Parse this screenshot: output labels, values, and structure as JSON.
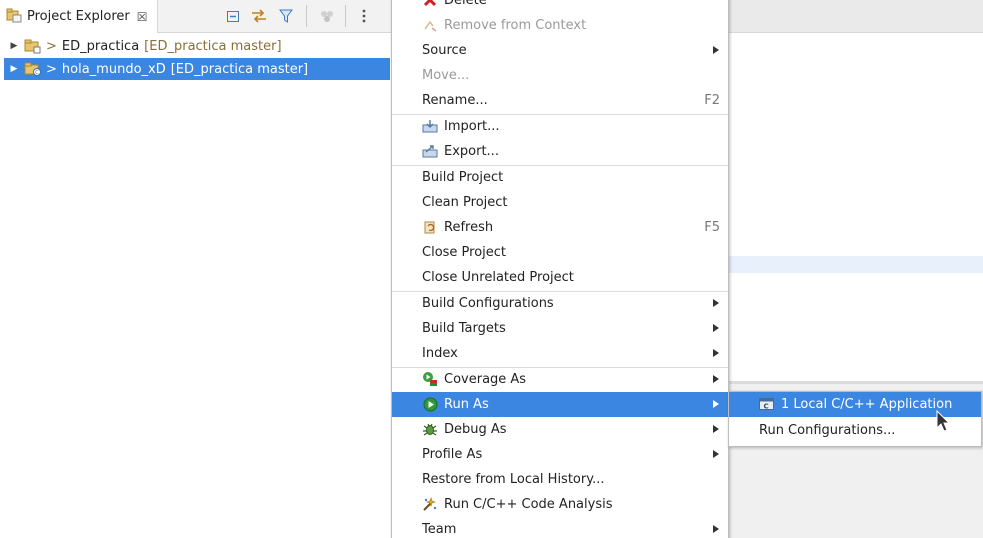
{
  "explorer": {
    "title": "Project Explorer",
    "close_icon": "close-icon",
    "toolbar": [
      "collapse-all-icon",
      "link-with-editor-icon",
      "filter-icon",
      "focus-icon",
      "view-menu-icon"
    ],
    "tree": [
      {
        "prefix": ">",
        "name": "ED_practica",
        "decoration": "[ED_practica master]",
        "selected": false
      },
      {
        "prefix": ">",
        "name": "hola_mundo_xD",
        "decoration": "[ED_practica master]",
        "selected": true
      }
    ]
  },
  "context_menu": {
    "items": [
      {
        "label": "Delete",
        "icon": "delete-icon"
      },
      {
        "label": "Remove from Context",
        "icon": "remove-context-icon",
        "disabled": true
      },
      {
        "label": "Source",
        "submenu": true
      },
      {
        "label": "Move...",
        "disabled": true
      },
      {
        "label": "Rename...",
        "accelerator": "F2"
      },
      {
        "label": "Import...",
        "icon": "import-icon"
      },
      {
        "label": "Export...",
        "icon": "export-icon"
      },
      {
        "label": "Build Project"
      },
      {
        "label": "Clean Project"
      },
      {
        "label": "Refresh",
        "icon": "refresh-icon",
        "accelerator": "F5"
      },
      {
        "label": "Close Project"
      },
      {
        "label": "Close Unrelated Project"
      },
      {
        "label": "Build Configurations",
        "submenu": true
      },
      {
        "label": "Build Targets",
        "submenu": true
      },
      {
        "label": "Index",
        "submenu": true
      },
      {
        "label": "Coverage As",
        "icon": "coverage-icon",
        "submenu": true
      },
      {
        "label": "Run As",
        "icon": "run-icon",
        "submenu": true,
        "active": true
      },
      {
        "label": "Debug As",
        "icon": "debug-icon",
        "submenu": true
      },
      {
        "label": "Profile As",
        "submenu": true
      },
      {
        "label": "Restore from Local History..."
      },
      {
        "label": "Run C/C++ Code Analysis",
        "icon": "code-analysis-icon"
      },
      {
        "label": "Team",
        "submenu": true
      }
    ]
  },
  "run_as_submenu": {
    "items": [
      {
        "label": "1 Local C/C++ Application",
        "icon": "c-application-icon",
        "active": true
      },
      {
        "label": "Run Configurations..."
      }
    ]
  },
  "colors": {
    "selection": "#3b86e0",
    "decoration": "#8a6d3b",
    "disabled": "#9a9a9a"
  }
}
